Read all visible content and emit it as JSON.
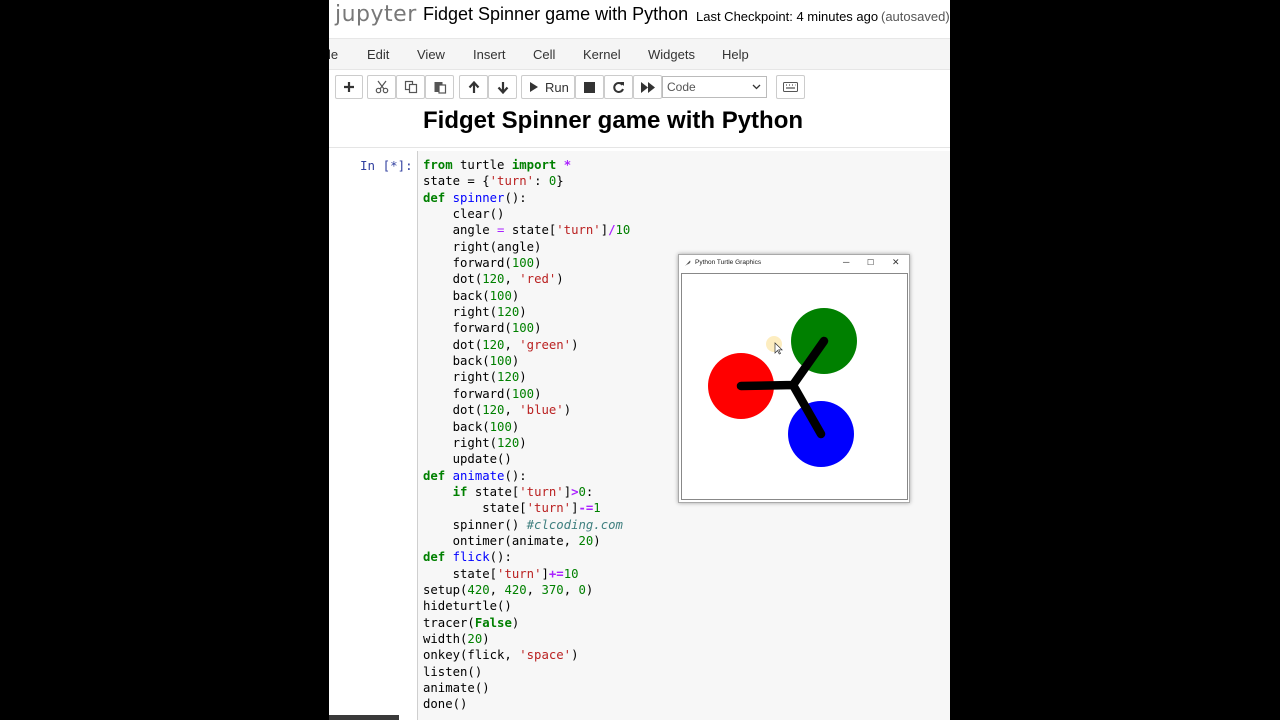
{
  "header": {
    "logo": "jupyter",
    "notebook_title": "Fidget Spinner game with Python",
    "checkpoint": "Last Checkpoint: 4 minutes ago",
    "autosave": "(autosaved)"
  },
  "menu": [
    "le",
    "Edit",
    "View",
    "Insert",
    "Cell",
    "Kernel",
    "Widgets",
    "Help"
  ],
  "toolbar": {
    "run_label": "Run",
    "cell_type": "Code",
    "icons": [
      "plus-icon",
      "scissors-icon",
      "copy-icon",
      "paste-icon",
      "arrow-up-icon",
      "arrow-down-icon",
      "play-icon",
      "stop-icon",
      "restart-icon",
      "fast-forward-icon",
      "keyboard-icon"
    ]
  },
  "markdown": {
    "heading": "Fidget Spinner game with Python"
  },
  "code_cell": {
    "prompt": "In [*]:",
    "lines": [
      "from turtle import *",
      "state = {'turn': 0}",
      "def spinner():",
      "    clear()",
      "    angle = state['turn']/10",
      "    right(angle)",
      "    forward(100)",
      "    dot(120, 'red')",
      "    back(100)",
      "    right(120)",
      "    forward(100)",
      "    dot(120, 'green')",
      "    back(100)",
      "    right(120)",
      "    forward(100)",
      "    dot(120, 'blue')",
      "    back(100)",
      "    right(120)",
      "    update()",
      "def animate():",
      "    if state['turn']>0:",
      "        state['turn']-=1",
      "    spinner() #clcoding.com",
      "    ontimer(animate, 20)",
      "def flick():",
      "    state['turn']+=10",
      "setup(420, 420, 370, 0)",
      "hideturtle()",
      "tracer(False)",
      "width(20)",
      "onkey(flick, 'space')",
      "listen()",
      "animate()",
      "done()"
    ]
  },
  "turtle_window": {
    "title": "Python Turtle Graphics",
    "minimize": "─",
    "maximize": "☐",
    "close": "✕",
    "colors": {
      "red": "#ff0000",
      "green": "#008000",
      "blue": "#0000ff",
      "arm": "#000000"
    }
  }
}
